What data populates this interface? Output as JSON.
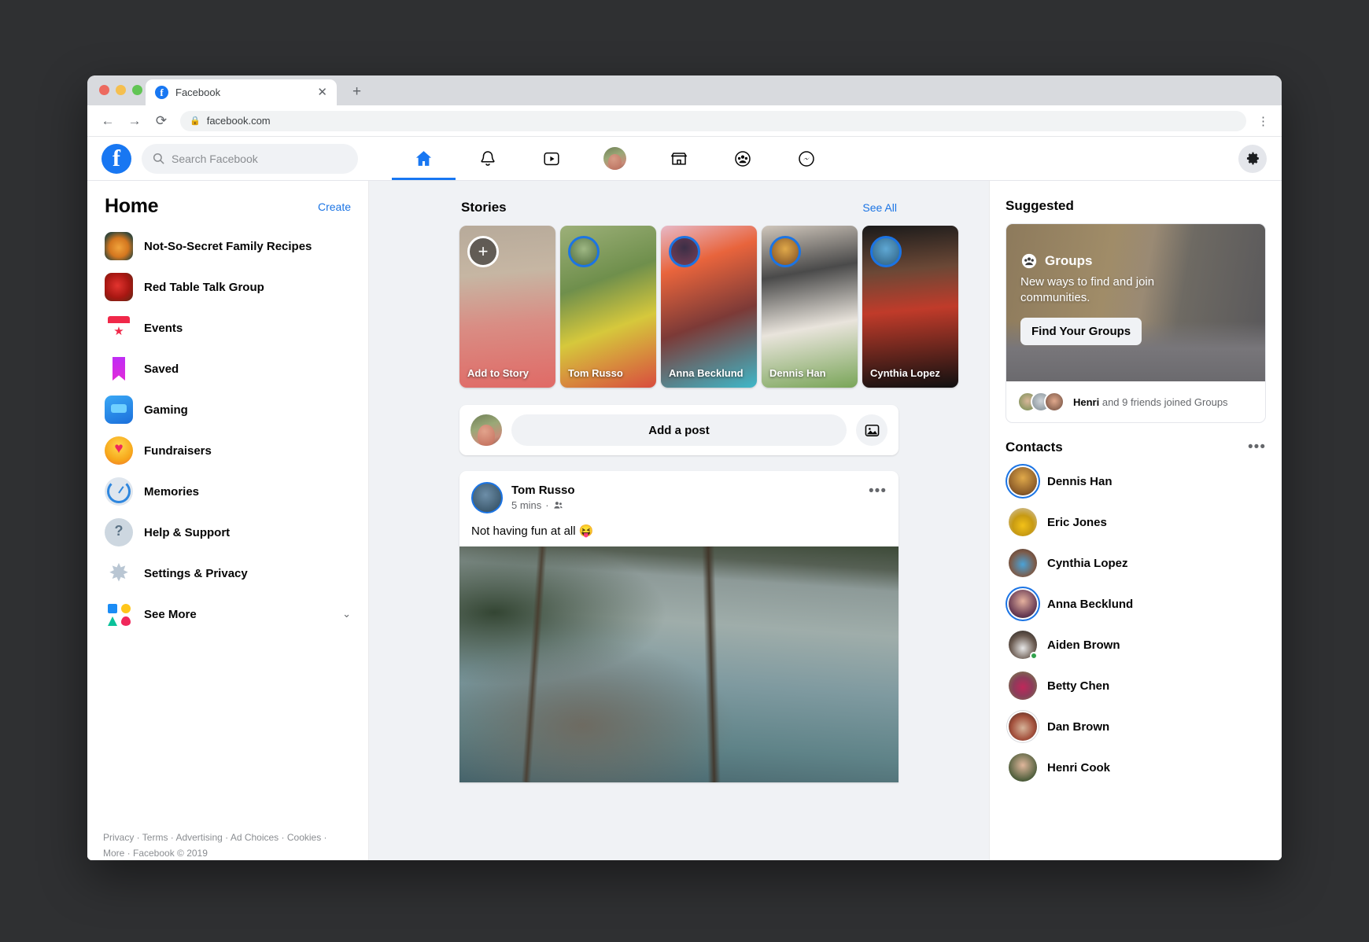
{
  "browser": {
    "tab_title": "Facebook",
    "tab_close": "✕",
    "new_tab": "+",
    "back": "←",
    "forward": "→",
    "reload": "⟳",
    "lock_icon": "lock-icon",
    "url": "facebook.com",
    "menu": "⋮"
  },
  "header": {
    "logo_letter": "f",
    "search_placeholder": "Search Facebook",
    "nav": [
      {
        "name": "home",
        "label": "Home",
        "active": true
      },
      {
        "name": "notifications",
        "label": "Notifications",
        "active": false
      },
      {
        "name": "watch",
        "label": "Watch",
        "active": false
      },
      {
        "name": "profile",
        "label": "Profile",
        "active": false
      },
      {
        "name": "marketplace",
        "label": "Marketplace",
        "active": false
      },
      {
        "name": "groups",
        "label": "Groups",
        "active": false
      },
      {
        "name": "messenger",
        "label": "Messenger",
        "active": false
      }
    ],
    "gear": "gear-icon"
  },
  "sidebar": {
    "title": "Home",
    "create_label": "Create",
    "items": [
      {
        "label": "Not-So-Secret Family Recipes",
        "icon": "recipes-icon"
      },
      {
        "label": "Red Table Talk Group",
        "icon": "red-table-icon"
      },
      {
        "label": "Events",
        "icon": "events-icon"
      },
      {
        "label": "Saved",
        "icon": "saved-bookmark-icon"
      },
      {
        "label": "Gaming",
        "icon": "gaming-icon"
      },
      {
        "label": "Fundraisers",
        "icon": "fundraisers-heart-icon"
      },
      {
        "label": "Memories",
        "icon": "memories-clock-icon"
      },
      {
        "label": "Help & Support",
        "icon": "help-question-icon"
      },
      {
        "label": "Settings & Privacy",
        "icon": "settings-gear-icon"
      },
      {
        "label": "See More",
        "icon": "see-more-shapes-icon",
        "chevron": "⌄"
      }
    ],
    "footer": {
      "line1": "Privacy · Terms · Advertising · Ad Choices · Cookies ·",
      "line2": "More · Facebook © 2019"
    }
  },
  "stories": {
    "title": "Stories",
    "see_all": "See All",
    "items": [
      {
        "name": "Add to Story",
        "add": true,
        "plus": "+"
      },
      {
        "name": "Tom Russo",
        "add": false
      },
      {
        "name": "Anna Becklund",
        "add": false
      },
      {
        "name": "Dennis Han",
        "add": false
      },
      {
        "name": "Cynthia Lopez",
        "add": false
      }
    ]
  },
  "composer": {
    "placeholder": "Add a post",
    "photo_icon": "photo-icon",
    "avatar": "user-avatar"
  },
  "post": {
    "author": "Tom Russo",
    "time": "5 mins",
    "audience_icon": "friends-icon",
    "separator": "·",
    "menu": "•••",
    "text": "Not having fun at all 😝",
    "image": "lake-jumping-photo"
  },
  "suggested": {
    "title": "Suggested",
    "badge_icon": "groups-icon",
    "badge_label": "Groups",
    "description": "New ways to find and join communities.",
    "button": "Find Your Groups",
    "footer_highlight": "Henri",
    "footer_rest": " and 9 friends joined Groups"
  },
  "contacts": {
    "title": "Contacts",
    "menu": "•••",
    "items": [
      {
        "name": "Dennis Han",
        "ring": "blue",
        "online": false
      },
      {
        "name": "Eric Jones",
        "ring": "none",
        "online": false
      },
      {
        "name": "Cynthia Lopez",
        "ring": "none",
        "online": false
      },
      {
        "name": "Anna Becklund",
        "ring": "blue",
        "online": false
      },
      {
        "name": "Aiden Brown",
        "ring": "none",
        "online": true
      },
      {
        "name": "Betty Chen",
        "ring": "none",
        "online": false
      },
      {
        "name": "Dan Brown",
        "ring": "gray",
        "online": false
      },
      {
        "name": "Henri Cook",
        "ring": "none",
        "online": false
      }
    ]
  },
  "colors": {
    "brand": "#1877f2",
    "link": "#1b74e4",
    "bg": "#f0f2f5",
    "text": "#050505",
    "muted": "#65676b",
    "online": "#31a24c"
  }
}
